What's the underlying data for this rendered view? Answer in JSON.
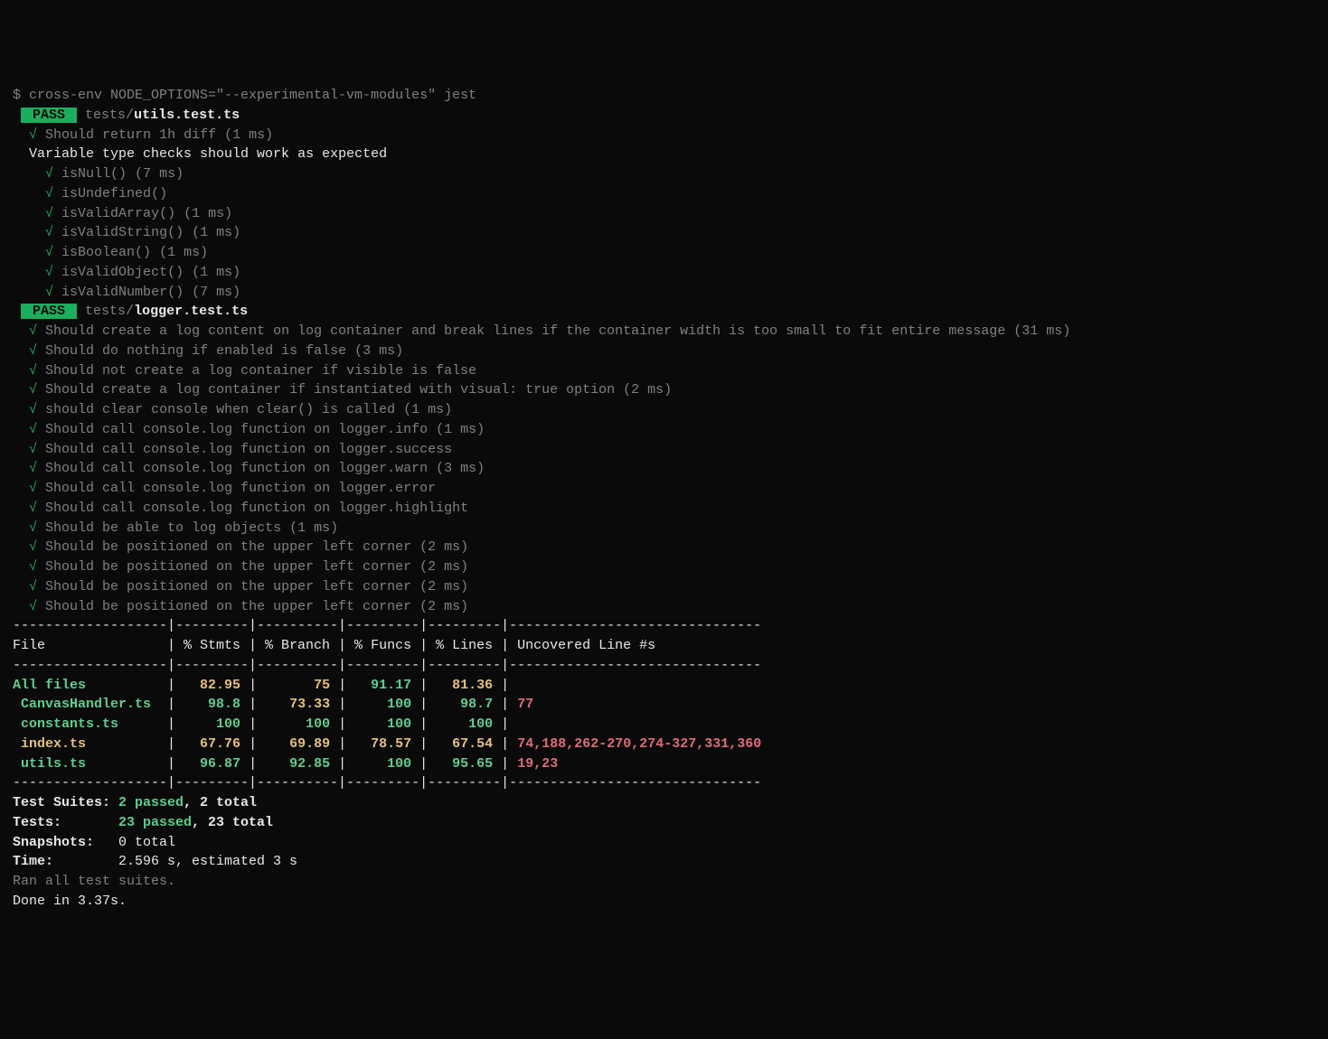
{
  "command": {
    "prompt": "$ ",
    "text": "cross-env NODE_OPTIONS=\"--experimental-vm-modules\" jest"
  },
  "pass_badge": "PASS",
  "suites": [
    {
      "path_prefix": "tests/",
      "file": "utils.test.ts",
      "lines": [
        {
          "indent": 1,
          "check": true,
          "text": "Should return 1h diff (1 ms)"
        },
        {
          "indent": 1,
          "check": false,
          "text": "Variable type checks should work as expected",
          "white": true
        },
        {
          "indent": 2,
          "check": true,
          "text": "isNull() (7 ms)"
        },
        {
          "indent": 2,
          "check": true,
          "text": "isUndefined()"
        },
        {
          "indent": 2,
          "check": true,
          "text": "isValidArray() (1 ms)"
        },
        {
          "indent": 2,
          "check": true,
          "text": "isValidString() (1 ms)"
        },
        {
          "indent": 2,
          "check": true,
          "text": "isBoolean() (1 ms)"
        },
        {
          "indent": 2,
          "check": true,
          "text": "isValidObject() (1 ms)"
        },
        {
          "indent": 2,
          "check": true,
          "text": "isValidNumber() (7 ms)"
        }
      ]
    },
    {
      "path_prefix": "tests/",
      "file": "logger.test.ts",
      "lines": [
        {
          "indent": 1,
          "check": true,
          "text": "Should create a log content on log container and break lines if the container width is too small to fit entire message (31 ms)"
        },
        {
          "indent": 1,
          "check": true,
          "text": "Should do nothing if enabled is false (3 ms)"
        },
        {
          "indent": 1,
          "check": true,
          "text": "Should not create a log container if visible is false"
        },
        {
          "indent": 1,
          "check": true,
          "text": "Should create a log container if instantiated with visual: true option (2 ms)"
        },
        {
          "indent": 1,
          "check": true,
          "text": "should clear console when clear() is called (1 ms)"
        },
        {
          "indent": 1,
          "check": true,
          "text": "Should call console.log function on logger.info (1 ms)"
        },
        {
          "indent": 1,
          "check": true,
          "text": "Should call console.log function on logger.success"
        },
        {
          "indent": 1,
          "check": true,
          "text": "Should call console.log function on logger.warn (3 ms)"
        },
        {
          "indent": 1,
          "check": true,
          "text": "Should call console.log function on logger.error"
        },
        {
          "indent": 1,
          "check": true,
          "text": "Should call console.log function on logger.highlight"
        },
        {
          "indent": 1,
          "check": true,
          "text": "Should be able to log objects (1 ms)"
        },
        {
          "indent": 1,
          "check": true,
          "text": "Should be positioned on the upper left corner (2 ms)"
        },
        {
          "indent": 1,
          "check": true,
          "text": "Should be positioned on the upper left corner (2 ms)"
        },
        {
          "indent": 1,
          "check": true,
          "text": "Should be positioned on the upper left corner (2 ms)"
        },
        {
          "indent": 1,
          "check": true,
          "text": "Should be positioned on the upper left corner (2 ms)"
        }
      ]
    }
  ],
  "coverage": {
    "sep_top": "-------------------|---------|----------|---------|---------|-------------------------------",
    "header": {
      "file": "File",
      "stmts": "% Stmts",
      "branch": "% Branch",
      "funcs": "% Funcs",
      "lines": "% Lines",
      "uncov": "Uncovered Line #s"
    },
    "rows": [
      {
        "file": "All files",
        "file_color": "green",
        "stmts": "82.95",
        "stmts_c": "yellow",
        "branch": "75",
        "branch_c": "yellow",
        "funcs": "91.17",
        "funcs_c": "green",
        "lines": "81.36",
        "lines_c": "yellow",
        "uncov": ""
      },
      {
        "file": " CanvasHandler.ts",
        "file_color": "green",
        "stmts": "98.8",
        "stmts_c": "green",
        "branch": "73.33",
        "branch_c": "yellow",
        "funcs": "100",
        "funcs_c": "green",
        "lines": "98.7",
        "lines_c": "green",
        "uncov": "77"
      },
      {
        "file": " constants.ts",
        "file_color": "green",
        "stmts": "100",
        "stmts_c": "green",
        "branch": "100",
        "branch_c": "green",
        "funcs": "100",
        "funcs_c": "green",
        "lines": "100",
        "lines_c": "green",
        "uncov": ""
      },
      {
        "file": " index.ts",
        "file_color": "yellow",
        "stmts": "67.76",
        "stmts_c": "yellow",
        "branch": "69.89",
        "branch_c": "yellow",
        "funcs": "78.57",
        "funcs_c": "yellow",
        "lines": "67.54",
        "lines_c": "yellow",
        "uncov": "74,188,262-270,274-327,331,360"
      },
      {
        "file": " utils.ts",
        "file_color": "green",
        "stmts": "96.87",
        "stmts_c": "green",
        "branch": "92.85",
        "branch_c": "green",
        "funcs": "100",
        "funcs_c": "green",
        "lines": "95.65",
        "lines_c": "green",
        "uncov": "19,23"
      }
    ]
  },
  "summary": {
    "test_suites_label": "Test Suites:",
    "test_suites_pass": "2 passed",
    "test_suites_rest": ", 2 total",
    "tests_label": "Tests:",
    "tests_pass": "23 passed",
    "tests_rest": ", 23 total",
    "snapshots_label": "Snapshots:",
    "snapshots_val": "0 total",
    "time_label": "Time:",
    "time_val": "2.596 s, estimated 3 s",
    "ran": "Ran all test suites.",
    "done": "Done in 3.37s."
  }
}
